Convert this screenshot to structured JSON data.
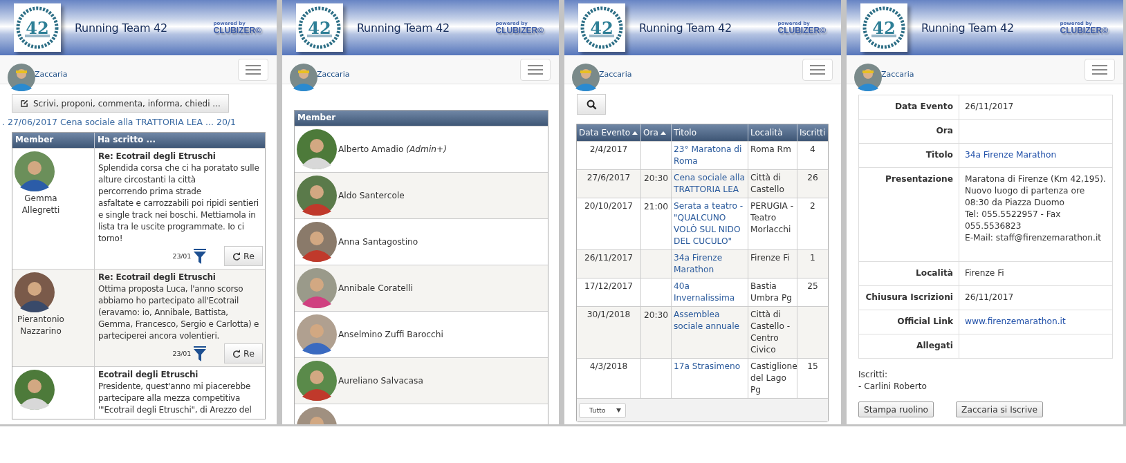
{
  "screens": [
    {
      "kind": "wall",
      "header": {
        "logo_text": "42",
        "title": "Running Team 42",
        "powered_by": "powered by",
        "brand": "CLUBIZER©"
      },
      "user": "Zaccaria",
      "compose_button": "Scrivi, proponi, commenta, informa, chiedi ...",
      "ticker": ". 27/06/2017 Cena sociale alla TRATTORIA LEA ... 20/1",
      "columns": [
        "Member",
        "Ha scritto ..."
      ],
      "posts": [
        {
          "author": "Gemma Allegretti",
          "title": "Re: Ecotrail degli Etruschi",
          "body": "Splendida corsa che ci ha poratato sulle alture circostanti la città\n percorrendo prima strade\nasfaltate e carrozzabili poi ripidi sentieri e single track nei boschi. Mettiamola in lista tra le uscite programmate. Io ci torno!",
          "date": "23/01",
          "reply": "Re"
        },
        {
          "author": "Pierantonio Nazzarino",
          "title": "Re: Ecotrail degli Etruschi",
          "body": "Ottima proposta Luca, l'anno scorso abbiamo ho partecipato all'Ecotrail (eravamo: io, Annibale, Battista, Gemma, Francesco, Sergio e Carlotta) e parteciperei ancora volentieri.",
          "date": "23/01",
          "reply": "Re"
        },
        {
          "title": "Ecotrail degli Etruschi",
          "body": "Presidente, quest'anno mi piacerebbe partecipare alla mezza competitiva '\"Ecotrail degli Etruschi\", di Arezzo del"
        }
      ]
    },
    {
      "kind": "members",
      "header": {
        "logo_text": "42",
        "title": "Running Team 42",
        "powered_by": "powered by",
        "brand": "CLUBIZER©"
      },
      "user": "Zaccaria",
      "columns": [
        "Member"
      ],
      "members": [
        {
          "name": "Alberto Amadio",
          "role": "(Admin+)",
          "avatar": true
        },
        {
          "name": "Aldo Santercole",
          "avatar": true
        },
        {
          "name": "Anna Santagostino",
          "avatar": true
        },
        {
          "name": "Annibale Coratelli",
          "avatar": true
        },
        {
          "name": "Anselmino Zuffi Barocchi",
          "avatar": true
        },
        {
          "name": "Aureliano Salvacasa",
          "avatar": true
        },
        {
          "avatar": true
        }
      ]
    },
    {
      "kind": "events",
      "header": {
        "logo_text": "42",
        "title": "Running Team 42",
        "powered_by": "powered by",
        "brand": "CLUBIZER©"
      },
      "user": "Zaccaria",
      "columns": [
        {
          "label": "Data Evento",
          "sorted": true
        },
        {
          "label": "Ora",
          "sorted": true
        },
        {
          "label": "Titolo",
          "sorted": false
        },
        {
          "label": "Località",
          "sorted": false
        },
        {
          "label": "Iscritti",
          "sorted": false
        }
      ],
      "events": [
        {
          "date": "2/4/2017",
          "title": "23° Maratona di Roma",
          "place": "Roma Rm",
          "count": "4"
        },
        {
          "date": "27/6/2017",
          "time": "20:30",
          "title": "Cena sociale alla TRATTORIA LEA",
          "place": "Città di Castello",
          "count": "26"
        },
        {
          "date": "20/10/2017",
          "time": "21:00",
          "title": "Serata a teatro - \"QUALCUNO VOLÒ SUL NIDO DEL CUCULO\"",
          "place": "PERUGIA - Teatro Morlacchi",
          "count": "2"
        },
        {
          "date": "26/11/2017",
          "title": "34a Firenze Marathon",
          "place": "Firenze Fi",
          "count": "1"
        },
        {
          "date": "17/12/2017",
          "title": "40a Invernalissima",
          "place": "Bastia Umbra Pg",
          "count": "25"
        },
        {
          "date": "30/1/2018",
          "time": "20:30",
          "title": "Assemblea sociale annuale",
          "place": "Città di Castello - Centro Civico"
        },
        {
          "date": "4/3/2018",
          "title": "17a Strasimeno",
          "place": "Castiglione del Lago Pg",
          "count": "15"
        }
      ],
      "filter": "Tutto"
    },
    {
      "kind": "detail",
      "header": {
        "logo_text": "42",
        "title": "Running Team 42",
        "powered_by": "powered by",
        "brand": "CLUBIZER©"
      },
      "user": "Zaccaria",
      "fields": [
        {
          "label": "Data Evento",
          "value": "26/11/2017",
          "link": false
        },
        {
          "label": "Ora"
        },
        {
          "label": "Titolo",
          "value": "34a Firenze Marathon",
          "link": true
        },
        {
          "label": "Presentazione",
          "value": "Maratona di Firenze (Km 42,195). Nuovo luogo di partenza ore 08:30 da Piazza Duomo\nTel: 055.5522957 - Fax 055.5536823\nE-Mail: staff@firenzemarathon.it",
          "link": false
        },
        {
          "label": "Località",
          "value": "Firenze Fi",
          "link": false
        },
        {
          "label": "Chiusura Iscrizioni",
          "value": "26/11/2017",
          "link": false
        },
        {
          "label": "Official Link",
          "value": "www.firenzemarathon.it",
          "link": true
        },
        {
          "label": "Allegati"
        }
      ],
      "enrolled_label": "Iscritti:",
      "enrolled": [
        "- Carlini Roberto"
      ],
      "buttons": [
        "Stampa ruolino",
        "Zaccaria si Iscrive"
      ]
    }
  ]
}
